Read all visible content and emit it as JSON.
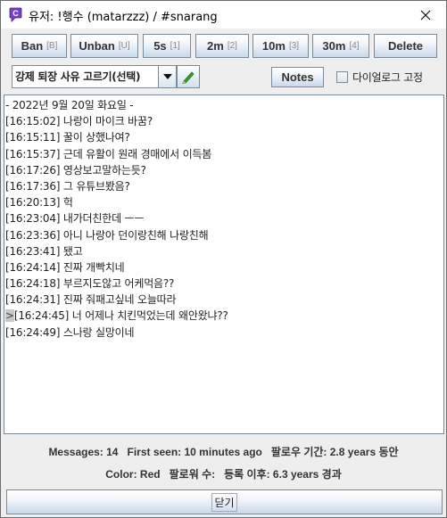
{
  "window": {
    "title": "유저: !행수 (matarzzz) / #snarang",
    "app_icon": "twitch-chat-icon",
    "close_icon": "close-icon"
  },
  "toolbar": {
    "buttons": [
      {
        "label": "Ban",
        "hint": "[B]"
      },
      {
        "label": "Unban",
        "hint": "[U]"
      },
      {
        "label": "5s",
        "hint": "[1]"
      },
      {
        "label": "2m",
        "hint": "[2]"
      },
      {
        "label": "10m",
        "hint": "[3]"
      },
      {
        "label": "30m",
        "hint": "[4]"
      },
      {
        "label": "Delete",
        "hint": ""
      }
    ]
  },
  "reason": {
    "selected": "강제 퇴장 사유 고르기(선택)",
    "dropdown_icon": "chevron-down-icon",
    "edit_icon": "pencil-icon"
  },
  "notes_label": "Notes",
  "pin_checkbox": {
    "label": "다이얼로그 고정",
    "checked": false
  },
  "chat": {
    "lines": [
      {
        "marker": "",
        "text": "- 2022년 9월 20일 화요일 -"
      },
      {
        "marker": "",
        "text": "[16:15:02] 나랑이 마이크 바꿈?"
      },
      {
        "marker": "",
        "text": "[16:15:11] 꿀이 상했나여?"
      },
      {
        "marker": "",
        "text": "[16:15:37] 근데 유활이 원래 경매에서 이득봄"
      },
      {
        "marker": "",
        "text": "[16:17:26] 영상보고말하는듯?"
      },
      {
        "marker": "",
        "text": "[16:17:36] 그 유튜브봤음?"
      },
      {
        "marker": "",
        "text": "[16:20:13] 헉"
      },
      {
        "marker": "",
        "text": "[16:23:04] 내가더친한데 ㅡㅡ"
      },
      {
        "marker": "",
        "text": "[16:23:36] 아니 나랑아 던이랑친해 나랑친해"
      },
      {
        "marker": "",
        "text": "[16:23:41] 됐고"
      },
      {
        "marker": "",
        "text": "[16:24:14] 진짜 개빡치네"
      },
      {
        "marker": "",
        "text": "[16:24:18] 부르지도않고 어케먹음??"
      },
      {
        "marker": "",
        "text": "[16:24:31] 진짜 줘패고싶네 오늘따라"
      },
      {
        "marker": ">",
        "text": "[16:24:45] 너 어제나 치킨먹었는데 왜안왔냐??"
      },
      {
        "marker": "",
        "text": "[16:24:49] 스나랑 실망이네"
      }
    ]
  },
  "stats": {
    "messages": "Messages: 14",
    "first_seen": "First seen: 10 minutes ago",
    "follow_age": "팔로우 기간: 2.8 years 동안",
    "color": "Color: Red",
    "followers": "팔로워 수:",
    "account_age": "등록 이후: 6.3 years 경과"
  },
  "close_button_label": "닫기"
}
